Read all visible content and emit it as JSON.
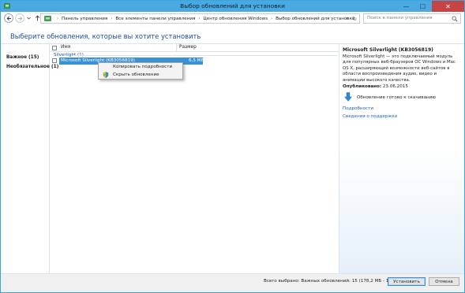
{
  "window": {
    "title": "Выбор обновлений для установки",
    "controls": {
      "minimize": "—",
      "maximize": "☐",
      "close": "✕"
    }
  },
  "nav": {
    "breadcrumbs": [
      "Панель управления",
      "Все элементы панели управления",
      "Центр обновления Windows",
      "Выбор обновлений для установки"
    ],
    "search_placeholder": "Поиск в панели управления"
  },
  "page": {
    "title": "Выберите обновления, которые вы хотите установить"
  },
  "categories": [
    {
      "label": "Важное (15)"
    },
    {
      "label": "Необязательное (1)"
    }
  ],
  "list": {
    "columns": {
      "name": "Имя",
      "size": "Размер"
    },
    "group": "Silverlight (1)",
    "rows": [
      {
        "name": "Microsoft Silverlight (KB3056819)",
        "size": "6,5 МБ",
        "selected": true
      }
    ]
  },
  "context_menu": {
    "items": [
      "Копировать подробности",
      "Скрыть обновление"
    ]
  },
  "details": {
    "title": "Microsoft Silverlight (KB3056819)",
    "description": "Microsoft Silverlight — это подключаемый модуль для популярных веб-браузеров ОС Windows и Mac OS X, расширяющий возможности веб-сайтов в области воспроизведения аудио, видео и анимации высокого качества.",
    "published_label": "Опубликовано:",
    "published_date": "23.06.2015",
    "status": "Обновление готово к скачиванию",
    "links": [
      "Подробности",
      "Сведения о поддержке"
    ]
  },
  "footer": {
    "summary": "Всего выбрано: Важных обновлений: 15 (178,2 МБ - 178,3 МБ)",
    "install_label": "Установить",
    "cancel_label": "Отмена"
  },
  "colors": {
    "titlebar": "#4aa9e0",
    "close": "#c74444",
    "selection": "#3a92d6",
    "link": "#1c62b8"
  }
}
